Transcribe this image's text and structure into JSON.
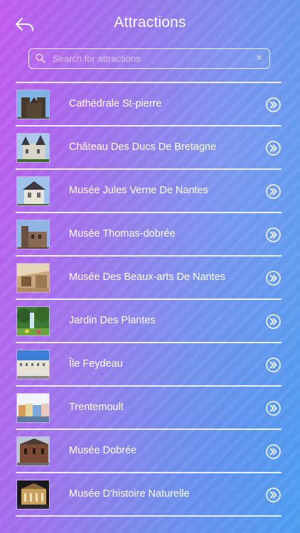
{
  "header": {
    "title": "Attractions",
    "back_icon": "back-arrow-icon"
  },
  "search": {
    "placeholder": "Search for attractions",
    "value": "",
    "icon": "search-icon",
    "clear_icon": "clear-icon",
    "clear_glyph": "×"
  },
  "attractions": [
    {
      "label": "Cathédrale St-pierre"
    },
    {
      "label": "Château Des Ducs De Bretagne"
    },
    {
      "label": "Musée Jules Verne De Nantes"
    },
    {
      "label": "Musée Thomas-dobrée"
    },
    {
      "label": "Musée Des Beaux-arts De Nantes"
    },
    {
      "label": "Jardin Des Plantes"
    },
    {
      "label": "Île Feydeau"
    },
    {
      "label": "Trentemoult"
    },
    {
      "label": "Musée Dobrée"
    },
    {
      "label": "Musée D'histoire Naturelle"
    }
  ],
  "row_icon": "double-chevron-right-icon",
  "colors": {
    "gradient_start": "#c35ef0",
    "gradient_end": "#4f9ff2",
    "text": "#ffffff"
  }
}
